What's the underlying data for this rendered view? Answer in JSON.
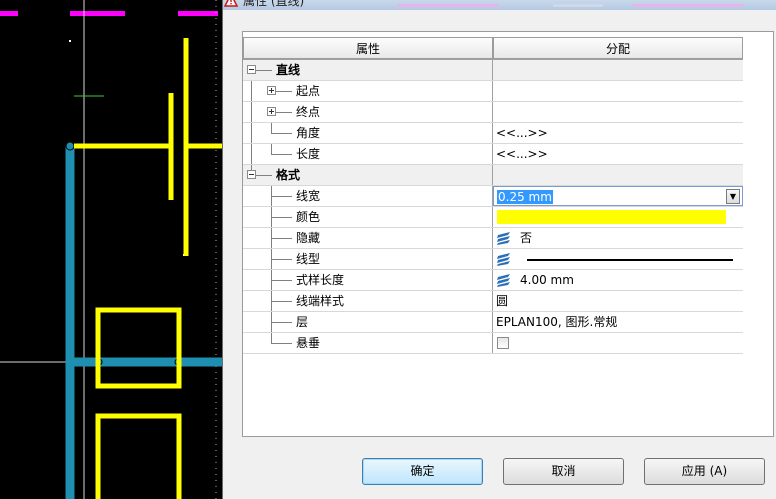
{
  "dialog": {
    "title": "属性 (直线)",
    "grid": {
      "header": {
        "property": "属性",
        "value": "分配"
      },
      "categories": [
        {
          "label": "直线",
          "items": [
            {
              "label": "起点",
              "value": "",
              "expandable": true
            },
            {
              "label": "终点",
              "value": "",
              "expandable": true
            },
            {
              "label": "角度",
              "value": "<<...>>"
            },
            {
              "label": "长度",
              "value": "<<...>>"
            }
          ]
        },
        {
          "label": "格式",
          "items": [
            {
              "label": "线宽",
              "value": "0.25 mm"
            },
            {
              "label": "颜色",
              "value": ""
            },
            {
              "label": "隐藏",
              "value": "否"
            },
            {
              "label": "线型",
              "value": ""
            },
            {
              "label": "式样长度",
              "value": "4.00 mm"
            },
            {
              "label": "线端样式",
              "value": "圆"
            },
            {
              "label": "层",
              "value": "EPLAN100, 图形.常规"
            },
            {
              "label": "悬垂",
              "value": "",
              "checked": false
            }
          ]
        }
      ]
    },
    "buttons": {
      "ok": "确定",
      "cancel": "取消",
      "apply": "应用 (A)"
    }
  },
  "colors": {
    "line_color_swatch": "#ffff00",
    "canvas_background": "#000000",
    "cad_yellow": "#ffff00",
    "cad_blue": "#1e8fb0",
    "cad_magenta": "#ff00ff",
    "selection": "#3399ff"
  },
  "icons": {
    "title": "warning-icon",
    "layer": "layer-stack-icon",
    "dropdown": "chevron-down-icon"
  }
}
